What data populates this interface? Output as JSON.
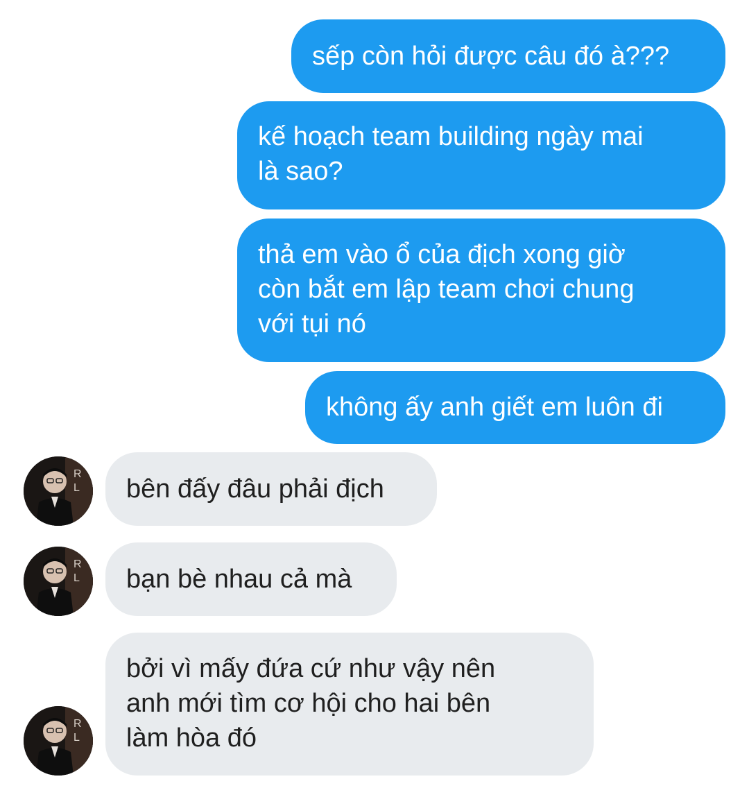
{
  "messages": {
    "sent": [
      "sếp còn hỏi được câu đó à???",
      "kế hoạch team building ngày mai\nlà sao?",
      "thả em vào ổ của địch xong giờ\ncòn bắt em lập team chơi chung\nvới tụi nó",
      "không ấy anh giết em luôn đi"
    ],
    "received": [
      "bên đấy đâu phải địch",
      "bạn bè nhau cả mà",
      "bởi vì mấy đứa cứ như vậy nên\nanh mới tìm cơ hội cho hai bên\nlàm hòa đó"
    ]
  },
  "colors": {
    "sent_bubble": "#1d9bf0",
    "received_bubble": "#e8ebee",
    "sent_text": "#ffffff",
    "received_text": "#1f1f1f"
  },
  "icons": {
    "avatar": "contact-avatar-photo"
  }
}
